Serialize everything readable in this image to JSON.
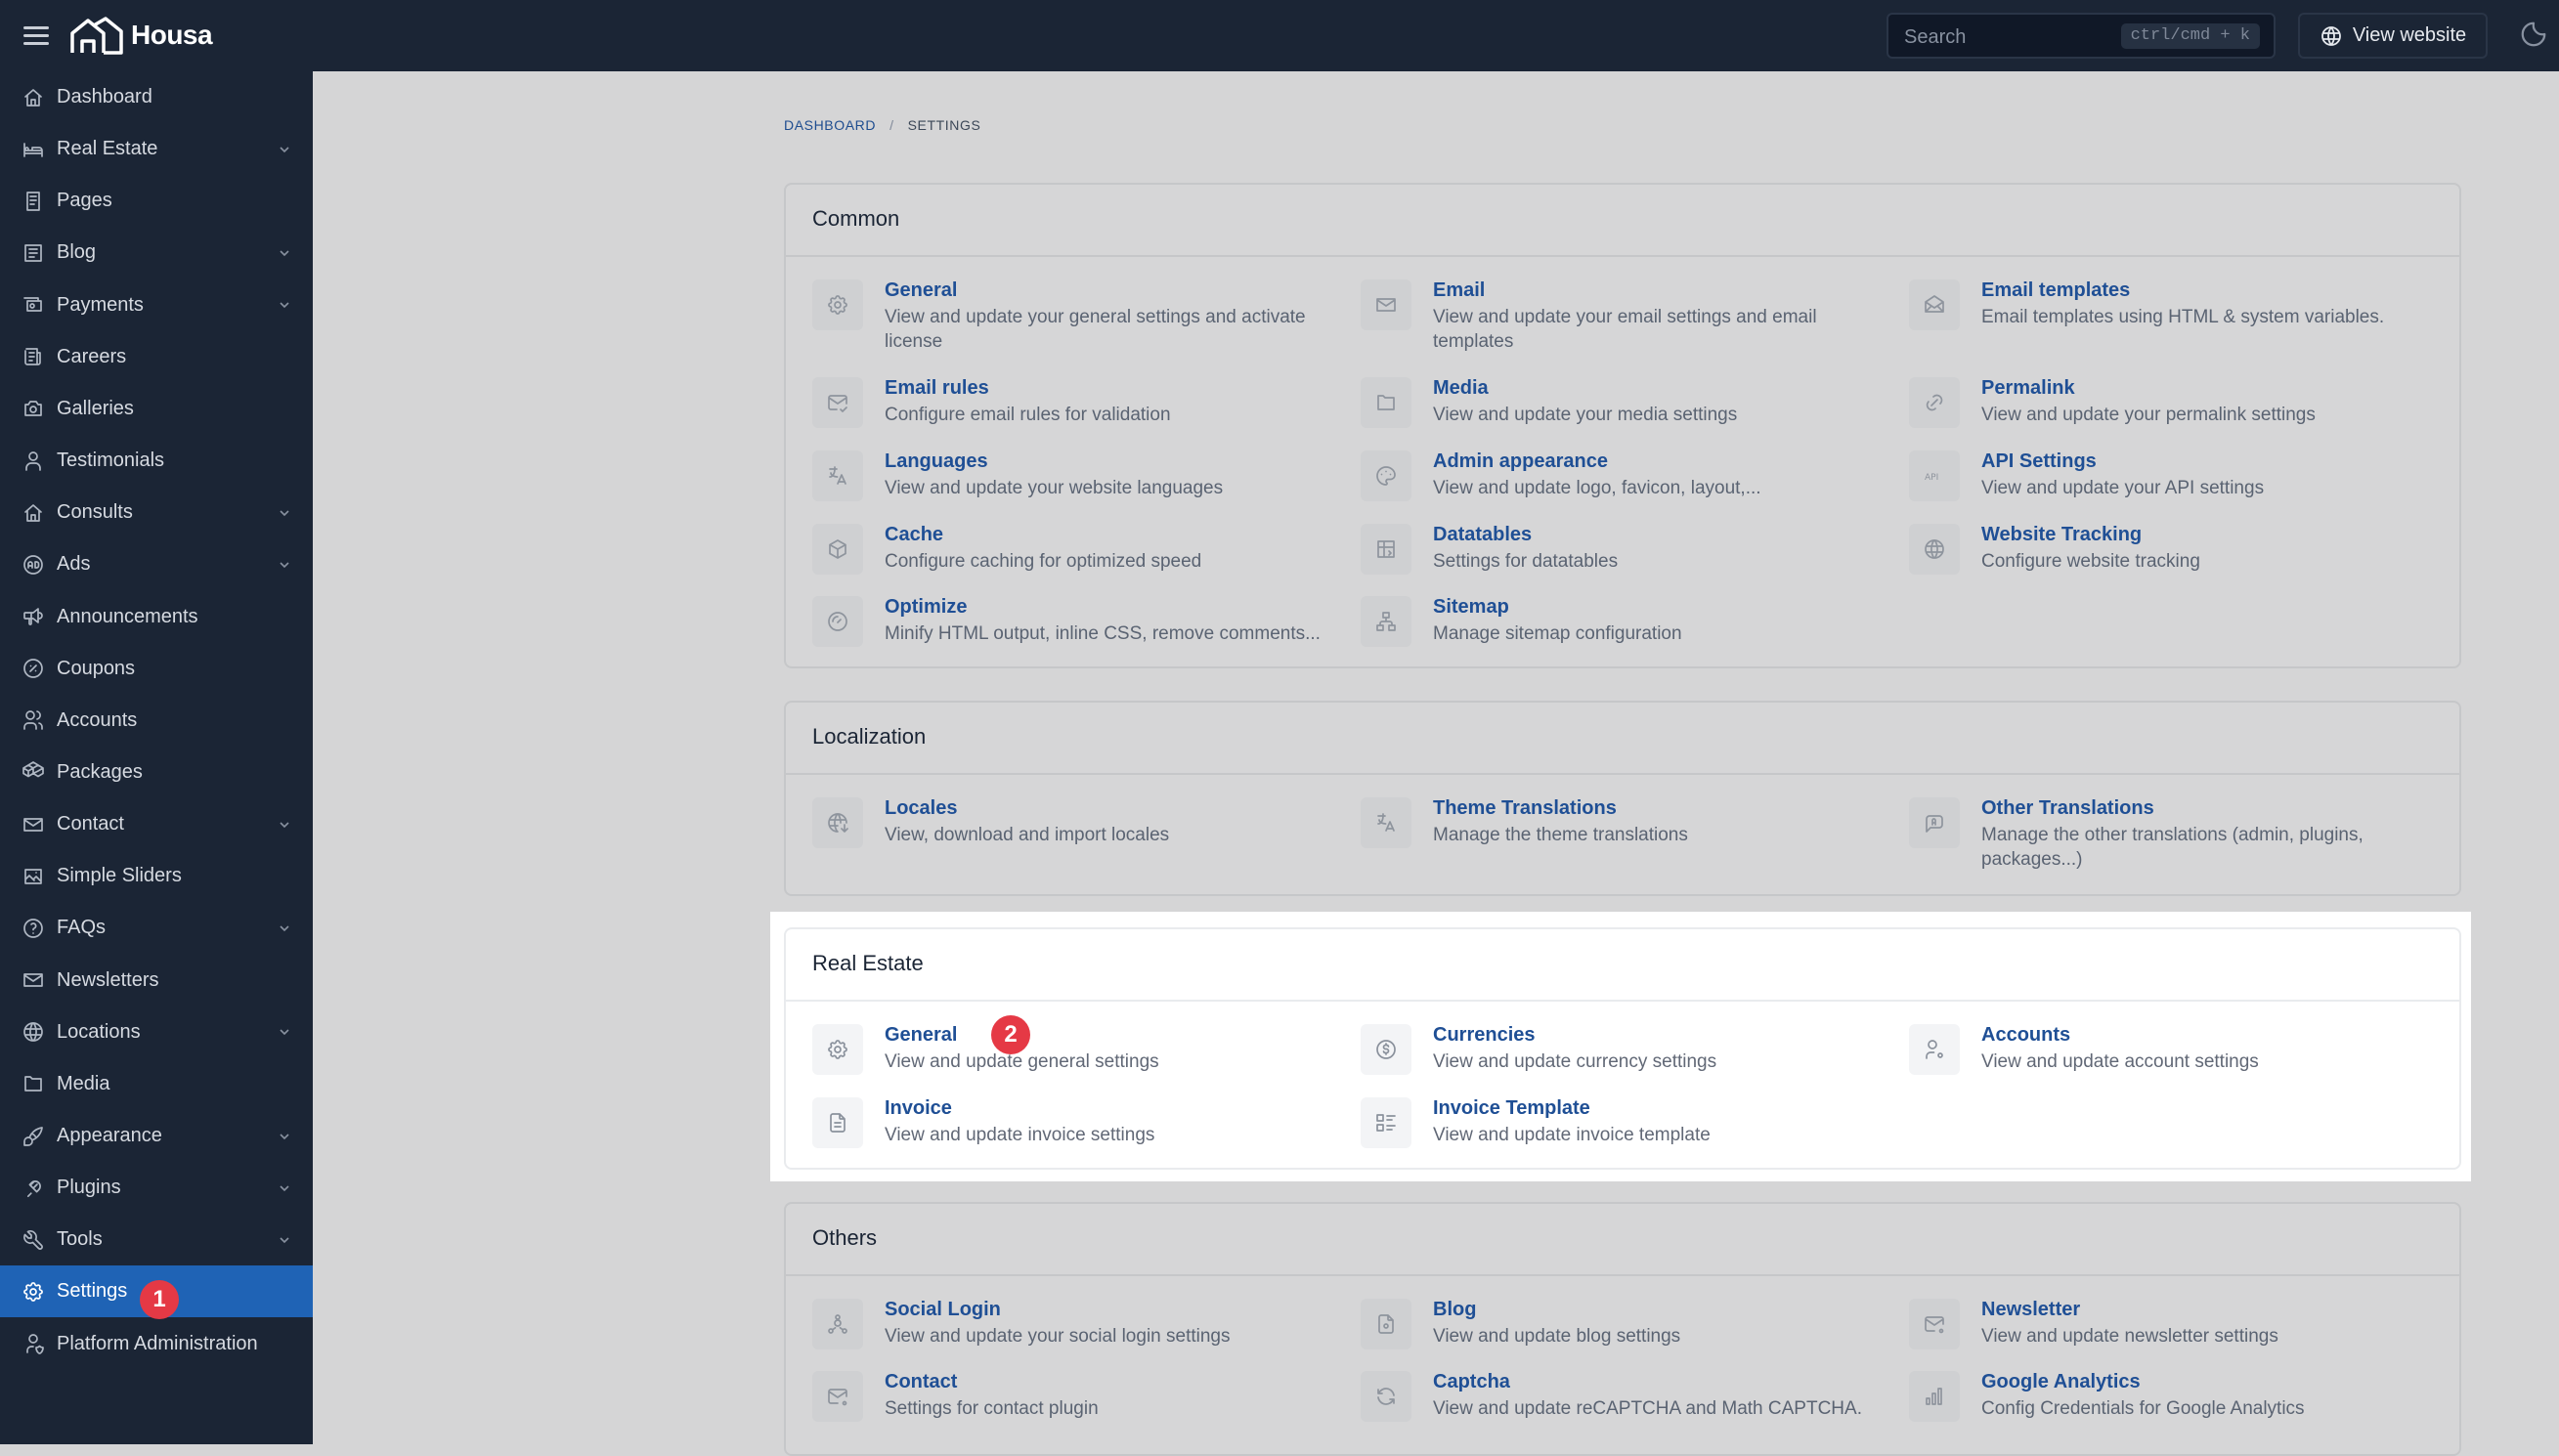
{
  "app": {
    "name": "Housa",
    "search_placeholder": "Search",
    "search_shortcut": "ctrl/cmd + k",
    "view_website_label": "View website"
  },
  "sidebar": {
    "items": [
      {
        "label": "Dashboard",
        "icon": "home-icon",
        "has_children": false
      },
      {
        "label": "Real Estate",
        "icon": "bed-icon",
        "has_children": true
      },
      {
        "label": "Pages",
        "icon": "page-icon",
        "has_children": false
      },
      {
        "label": "Blog",
        "icon": "article-icon",
        "has_children": true
      },
      {
        "label": "Payments",
        "icon": "cash-icon",
        "has_children": true
      },
      {
        "label": "Careers",
        "icon": "newspaper-icon",
        "has_children": false
      },
      {
        "label": "Galleries",
        "icon": "camera-icon",
        "has_children": false
      },
      {
        "label": "Testimonials",
        "icon": "user-icon",
        "has_children": false
      },
      {
        "label": "Consults",
        "icon": "home-icon",
        "has_children": true
      },
      {
        "label": "Ads",
        "icon": "ad-icon",
        "has_children": true
      },
      {
        "label": "Announcements",
        "icon": "speakerphone-icon",
        "has_children": false
      },
      {
        "label": "Coupons",
        "icon": "discount-icon",
        "has_children": false
      },
      {
        "label": "Accounts",
        "icon": "users-icon",
        "has_children": false
      },
      {
        "label": "Packages",
        "icon": "packages-icon",
        "has_children": false
      },
      {
        "label": "Contact",
        "icon": "mail-icon",
        "has_children": true
      },
      {
        "label": "Simple Sliders",
        "icon": "slideshow-icon",
        "has_children": false
      },
      {
        "label": "FAQs",
        "icon": "help-icon",
        "has_children": true
      },
      {
        "label": "Newsletters",
        "icon": "mail-icon",
        "has_children": false
      },
      {
        "label": "Locations",
        "icon": "world-icon",
        "has_children": true
      },
      {
        "label": "Media",
        "icon": "folder-icon",
        "has_children": false
      },
      {
        "label": "Appearance",
        "icon": "brush-icon",
        "has_children": true
      },
      {
        "label": "Plugins",
        "icon": "plug-icon",
        "has_children": true
      },
      {
        "label": "Tools",
        "icon": "tool-icon",
        "has_children": true
      },
      {
        "label": "Settings",
        "icon": "settings-icon",
        "has_children": false,
        "active": true
      },
      {
        "label": "Platform Administration",
        "icon": "user-shield-icon",
        "has_children": false
      }
    ]
  },
  "annotations": {
    "step1": "1",
    "step2": "2"
  },
  "breadcrumb": {
    "dashboard": "DASHBOARD",
    "separator": "/",
    "current": "SETTINGS"
  },
  "sections": [
    {
      "title": "Common",
      "items": [
        {
          "name": "General",
          "desc": "View and update your general settings and activate license",
          "icon": "settings-icon"
        },
        {
          "name": "Email",
          "desc": "View and update your email settings and email templates",
          "icon": "mail-icon"
        },
        {
          "name": "Email templates",
          "desc": "Email templates using HTML & system variables.",
          "icon": "mail-opened-icon"
        },
        {
          "name": "Email rules",
          "desc": "Configure email rules for validation",
          "icon": "mail-check-icon"
        },
        {
          "name": "Media",
          "desc": "View and update your media settings",
          "icon": "folder-icon"
        },
        {
          "name": "Permalink",
          "desc": "View and update your permalink settings",
          "icon": "link-icon"
        },
        {
          "name": "Languages",
          "desc": "View and update your website languages",
          "icon": "language-icon"
        },
        {
          "name": "Admin appearance",
          "desc": "View and update logo, favicon, layout,...",
          "icon": "palette-icon"
        },
        {
          "name": "API Settings",
          "desc": "View and update your API settings",
          "icon": "api-icon"
        },
        {
          "name": "Cache",
          "desc": "Configure caching for optimized speed",
          "icon": "box-icon"
        },
        {
          "name": "Datatables",
          "desc": "Settings for datatables",
          "icon": "table-icon"
        },
        {
          "name": "Website Tracking",
          "desc": "Configure website tracking",
          "icon": "world-icon"
        },
        {
          "name": "Optimize",
          "desc": "Minify HTML output, inline CSS, remove comments...",
          "icon": "gauge-icon"
        },
        {
          "name": "Sitemap",
          "desc": "Manage sitemap configuration",
          "icon": "sitemap-icon"
        }
      ]
    },
    {
      "title": "Localization",
      "items": [
        {
          "name": "Locales",
          "desc": "View, download and import locales",
          "icon": "world-download-icon"
        },
        {
          "name": "Theme Translations",
          "desc": "Manage the theme translations",
          "icon": "language-icon"
        },
        {
          "name": "Other Translations",
          "desc": "Manage the other translations (admin, plugins, packages...)",
          "icon": "message-language-icon"
        }
      ]
    },
    {
      "title": "Real Estate",
      "items": [
        {
          "name": "General",
          "desc": "View and update general settings",
          "icon": "settings-icon"
        },
        {
          "name": "Currencies",
          "desc": "View and update currency settings",
          "icon": "currency-dollar-icon"
        },
        {
          "name": "Accounts",
          "desc": "View and update account settings",
          "icon": "user-cog-icon"
        },
        {
          "name": "Invoice",
          "desc": "View and update invoice settings",
          "icon": "file-invoice-icon"
        },
        {
          "name": "Invoice Template",
          "desc": "View and update invoice template",
          "icon": "list-details-icon"
        }
      ]
    },
    {
      "title": "Others",
      "items": [
        {
          "name": "Social Login",
          "desc": "View and update your social login settings",
          "icon": "social-icon"
        },
        {
          "name": "Blog",
          "desc": "View and update blog settings",
          "icon": "file-settings-icon"
        },
        {
          "name": "Newsletter",
          "desc": "View and update newsletter settings",
          "icon": "mail-cog-icon"
        },
        {
          "name": "Contact",
          "desc": "Settings for contact plugin",
          "icon": "mail-cog-icon"
        },
        {
          "name": "Captcha",
          "desc": "View and update reCAPTCHA and Math CAPTCHA.",
          "icon": "refresh-icon"
        },
        {
          "name": "Google Analytics",
          "desc": "Config Credentials for Google Analytics",
          "icon": "chart-bar-icon"
        }
      ]
    }
  ]
}
